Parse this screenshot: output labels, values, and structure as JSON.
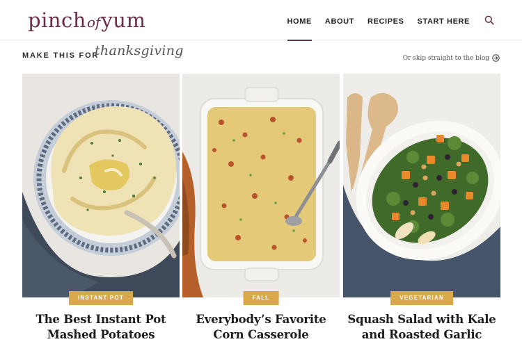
{
  "logo": {
    "part1": "pinch",
    "part2": "of",
    "part3": "yum"
  },
  "nav": [
    {
      "label": "HOME",
      "active": true
    },
    {
      "label": "ABOUT",
      "active": false
    },
    {
      "label": "RECIPES",
      "active": false
    },
    {
      "label": "START HERE",
      "active": false
    }
  ],
  "nav_icon": "search-icon",
  "banner": {
    "prefix": "MAKE THIS FOR",
    "holiday": "thanksgiving",
    "skip_link": "Or skip straight to the blog",
    "skip_icon": "arrow-right-circle-icon"
  },
  "cards": [
    {
      "category": "INSTANT POT",
      "title_line1": "The Best Instant Pot",
      "title_line2": "Mashed Potatoes"
    },
    {
      "category": "FALL",
      "title_line1": "Everybody’s Favorite",
      "title_line2": "Corn Casserole"
    },
    {
      "category": "VEGETARIAN",
      "title_line1": "Squash Salad with Kale",
      "title_line2": "and Roasted Garlic"
    }
  ],
  "colors": {
    "brand": "#6b2d48",
    "badge": "#d9a84a",
    "text": "#1c1c1c"
  }
}
